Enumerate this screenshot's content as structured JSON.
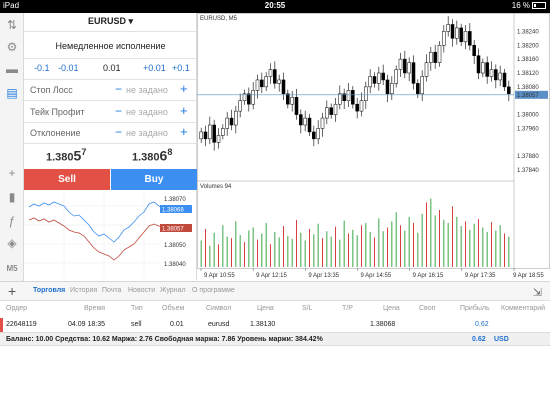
{
  "statusbar": {
    "device": "iPad",
    "time": "20:55",
    "battery": "16 %"
  },
  "rail": {
    "icons": [
      "quotes-icon",
      "accounts-icon",
      "chat-icon",
      "order-icon",
      "crosshair-icon",
      "chart-type-icon",
      "indicator-icon",
      "objects-icon",
      "timeframe-icon"
    ],
    "timeframe_label": "M5"
  },
  "order_panel": {
    "symbol": "EURUSD ▾",
    "execution": "Немедленное исполнение",
    "volume_steps": [
      "-0.1",
      "-0.01",
      "0.01",
      "+0.01",
      "+0.1"
    ],
    "stop_loss_label": "Стоп Лосс",
    "take_profit_label": "Тейк Профит",
    "deviation_label": "Отклонение",
    "not_set": "не задано",
    "minus": "−",
    "plus": "+",
    "bid_main": "1.380",
    "bid_big": "5",
    "bid_sup": "7",
    "ask_main": "1.380",
    "ask_big": "6",
    "ask_sup": "8",
    "sell_label": "Sell",
    "buy_label": "Buy"
  },
  "mini_chart": {
    "ask_tag": "1.38068",
    "bid_tag": "1.38057",
    "ticks": [
      "1.38070",
      "1.38060",
      "1.38050",
      "1.38040"
    ]
  },
  "chart_data": {
    "type": "candlestick",
    "title": "EURUSD, M5",
    "y_ticks": [
      "1.38240",
      "1.38200",
      "1.38160",
      "1.38120",
      "1.38080",
      "1.38057",
      "1.38000",
      "1.37960",
      "1.37880",
      "1.37840"
    ],
    "current_price": "1.38057",
    "ylim": [
      1.3782,
      1.3827
    ],
    "volume_label": "Volumes 94",
    "x_ticks": [
      "9 Apr 10:55",
      "9 Apr 12:15",
      "9 Apr 13:35",
      "9 Apr 14:55",
      "9 Apr 16:15",
      "9 Apr 17:35",
      "9 Apr 18:55"
    ],
    "candles_close": [
      1.3795,
      1.3793,
      1.3797,
      1.3792,
      1.3794,
      1.3796,
      1.3799,
      1.3797,
      1.3801,
      1.3804,
      1.3806,
      1.3803,
      1.3807,
      1.381,
      1.3808,
      1.3811,
      1.3813,
      1.3809,
      1.381,
      1.3806,
      1.3803,
      1.3805,
      1.38,
      1.3797,
      1.3799,
      1.3795,
      1.3793,
      1.3796,
      1.3799,
      1.3802,
      1.38,
      1.3803,
      1.3806,
      1.3804,
      1.3807,
      1.3803,
      1.3801,
      1.3804,
      1.3808,
      1.3811,
      1.3809,
      1.3812,
      1.381,
      1.3806,
      1.3809,
      1.3813,
      1.3816,
      1.3812,
      1.3815,
      1.3809,
      1.3806,
      1.3811,
      1.3815,
      1.3818,
      1.3815,
      1.382,
      1.3824,
      1.3826,
      1.3822,
      1.3825,
      1.3821,
      1.3824,
      1.382,
      1.3817,
      1.3812,
      1.3815,
      1.3811,
      1.3813,
      1.381,
      1.3812,
      1.3808,
      1.3806
    ],
    "volumes": [
      35,
      50,
      28,
      45,
      30,
      55,
      40,
      38,
      60,
      42,
      33,
      48,
      52,
      36,
      44,
      58,
      30,
      46,
      39,
      54,
      41,
      37,
      62,
      45,
      35,
      50,
      43,
      57,
      38,
      47,
      40,
      53,
      36,
      61,
      44,
      49,
      42,
      55,
      58,
      46,
      39,
      64,
      47,
      52,
      60,
      72,
      55,
      48,
      66,
      58,
      45,
      70,
      85,
      90,
      68,
      75,
      62,
      58,
      80,
      66,
      54,
      60,
      49,
      57,
      63,
      52,
      46,
      59,
      48,
      55,
      44,
      40
    ]
  },
  "bottom": {
    "tabs": [
      "Торговля",
      "История",
      "Почта",
      "Новости",
      "Журнал",
      "О программе"
    ],
    "columns": [
      "Ордер",
      "Время",
      "Тип",
      "Объем",
      "Символ",
      "Цена",
      "S/L",
      "T/P",
      "Цена",
      "Своп",
      "Прибыль",
      "Комментарий"
    ],
    "rows": [
      {
        "order": "22648119",
        "time": "04.09 18:35",
        "type": "sell",
        "volume": "0.01",
        "symbol": "eurusd",
        "price": "1.38130",
        "sl": "",
        "tp": "",
        "cur_price": "1.38068",
        "swap": "",
        "profit": "0.62",
        "comment": ""
      }
    ],
    "summary": "Баланс: 10.00 Средства: 10.62 Маржа: 2.76 Свободная маржа: 7.86 Уровень маржи: 384.42%",
    "summary_profit": "0.62",
    "summary_currency": "USD"
  }
}
